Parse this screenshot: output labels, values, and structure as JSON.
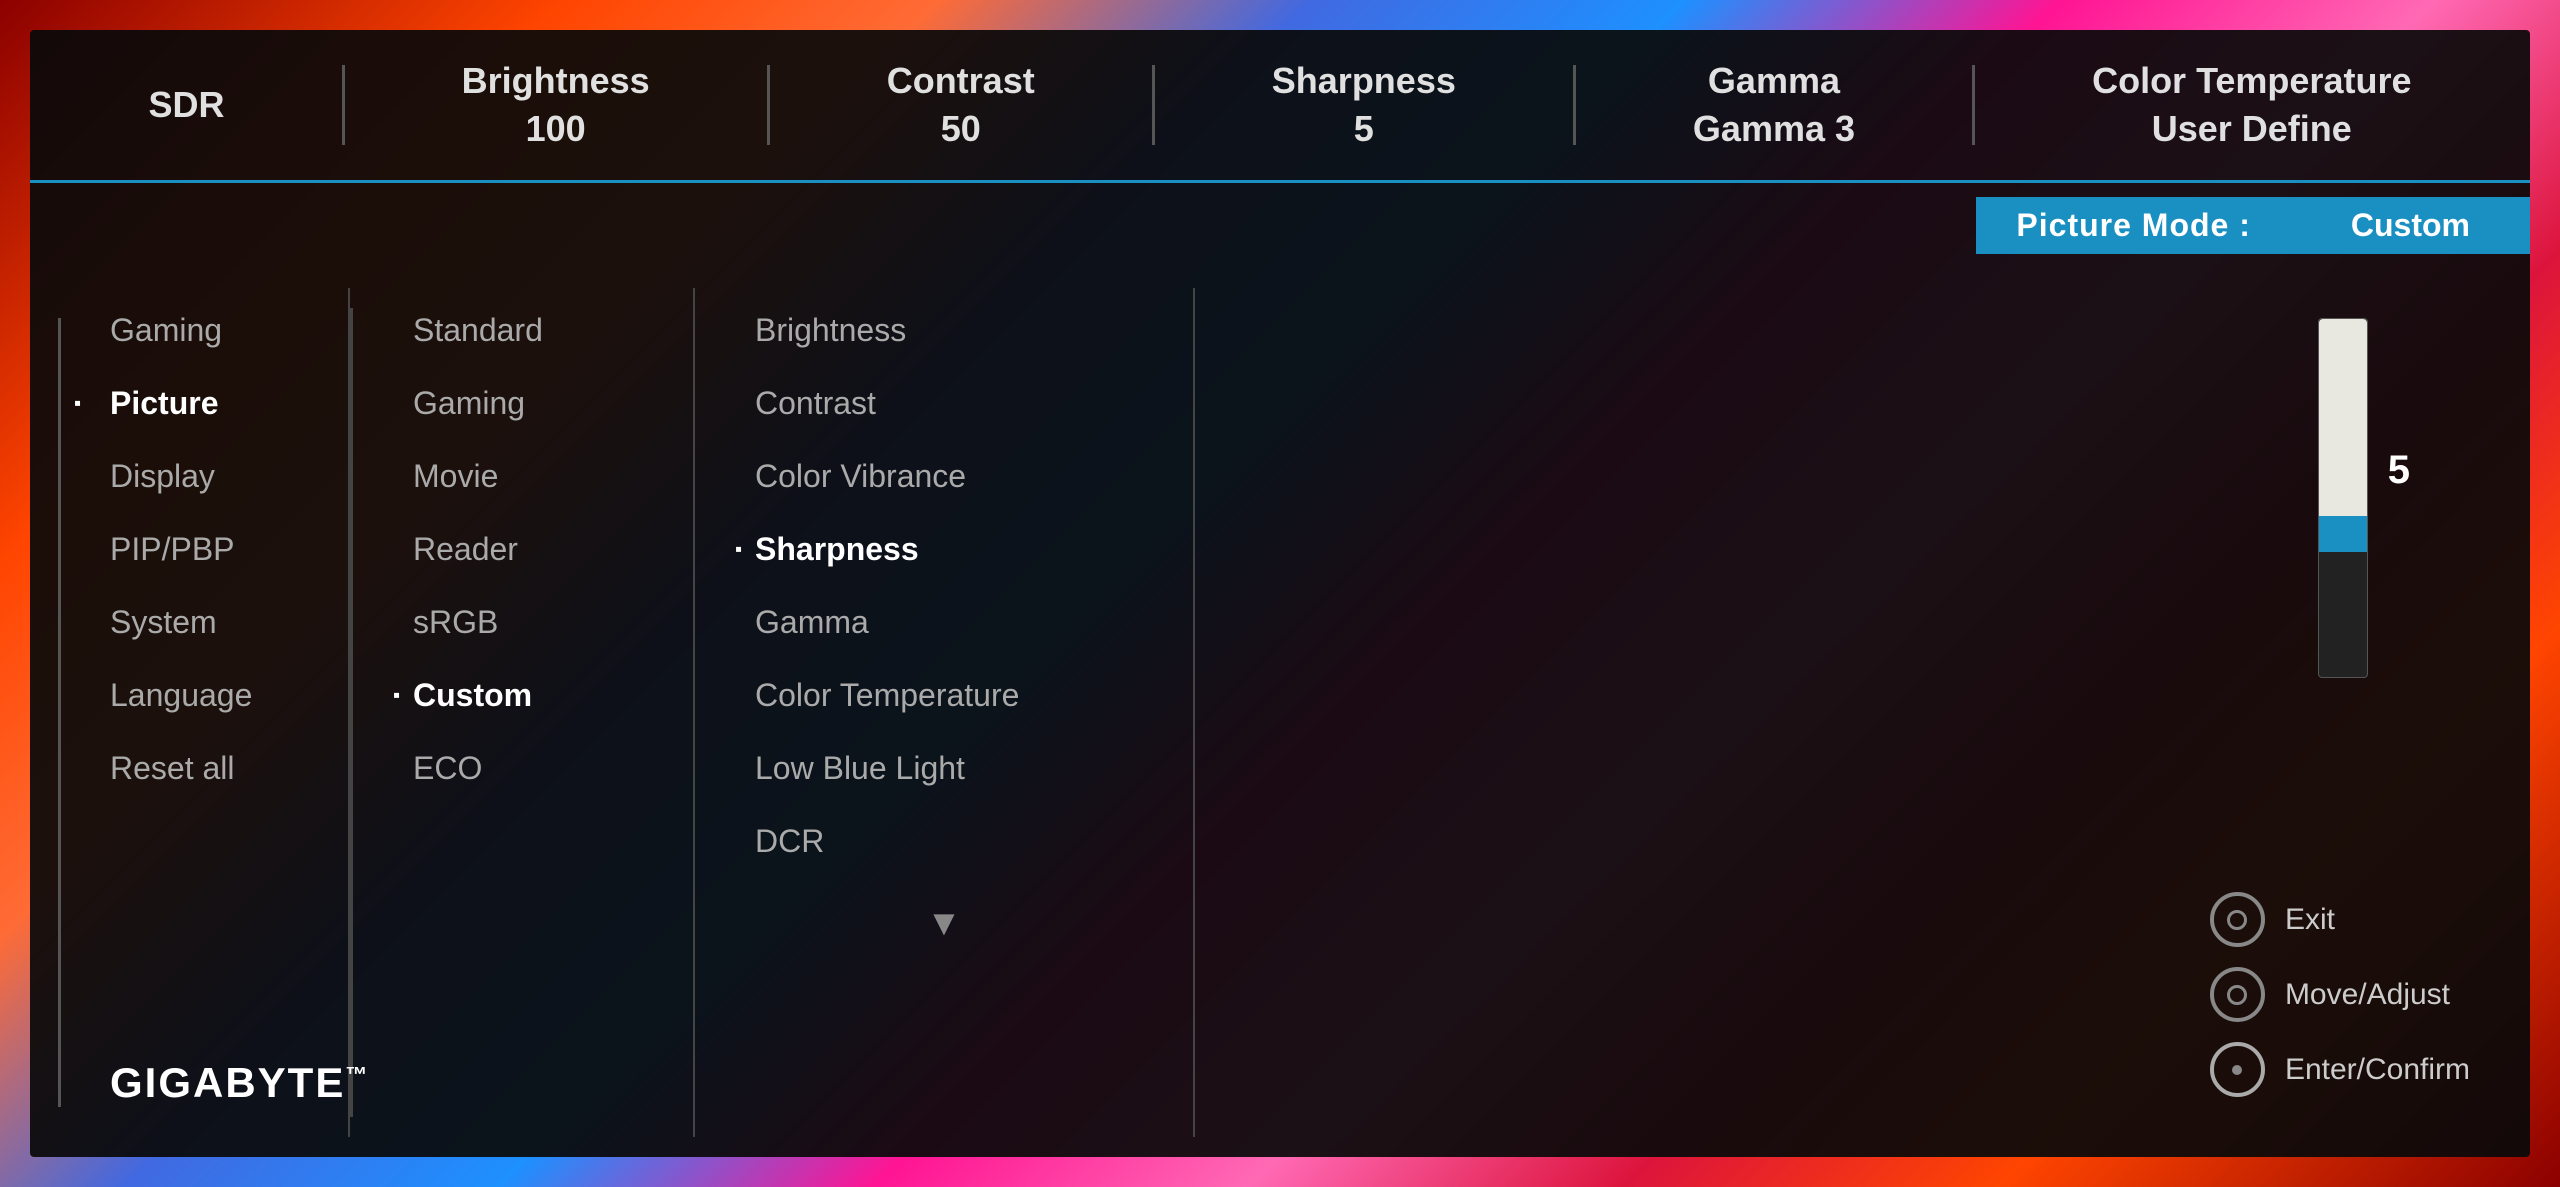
{
  "background": {
    "description": "colorful gaming art background"
  },
  "topBar": {
    "items": [
      {
        "label": "SDR",
        "value": ""
      },
      {
        "label": "Brightness",
        "value": "100"
      },
      {
        "label": "Contrast",
        "value": "50"
      },
      {
        "label": "Sharpness",
        "value": "5"
      },
      {
        "label": "Gamma",
        "value": "Gamma 3"
      },
      {
        "label": "Color Temperature",
        "value": "User Define"
      }
    ]
  },
  "pictureMode": {
    "label": "Picture Mode  :",
    "value": "Custom"
  },
  "leftMenu": {
    "items": [
      {
        "label": "Gaming",
        "active": false
      },
      {
        "label": "Picture",
        "active": true
      },
      {
        "label": "Display",
        "active": false
      },
      {
        "label": "PIP/PBP",
        "active": false
      },
      {
        "label": "System",
        "active": false
      },
      {
        "label": "Language",
        "active": false
      },
      {
        "label": "Reset all",
        "active": false
      }
    ]
  },
  "submenu": {
    "items": [
      {
        "label": "Standard",
        "active": false
      },
      {
        "label": "Gaming",
        "active": false
      },
      {
        "label": "Movie",
        "active": false
      },
      {
        "label": "Reader",
        "active": false
      },
      {
        "label": "sRGB",
        "active": false
      },
      {
        "label": "Custom",
        "active": true
      },
      {
        "label": "ECO",
        "active": false
      }
    ]
  },
  "settings": {
    "items": [
      {
        "label": "Brightness",
        "active": false
      },
      {
        "label": "Contrast",
        "active": false
      },
      {
        "label": "Color Vibrance",
        "active": false
      },
      {
        "label": "Sharpness",
        "active": true
      },
      {
        "label": "Gamma",
        "active": false
      },
      {
        "label": "Color Temperature",
        "active": false
      },
      {
        "label": "Low Blue Light",
        "active": false
      },
      {
        "label": "DCR",
        "active": false
      }
    ]
  },
  "slider": {
    "value": "5",
    "label": "5"
  },
  "controls": [
    {
      "label": "Exit",
      "iconType": "circle"
    },
    {
      "label": "Move/Adjust",
      "iconType": "circle-inner"
    },
    {
      "label": "Enter/Confirm",
      "iconType": "circle-dot"
    }
  ],
  "brand": {
    "name": "GIGABYTE",
    "trademark": "™"
  }
}
